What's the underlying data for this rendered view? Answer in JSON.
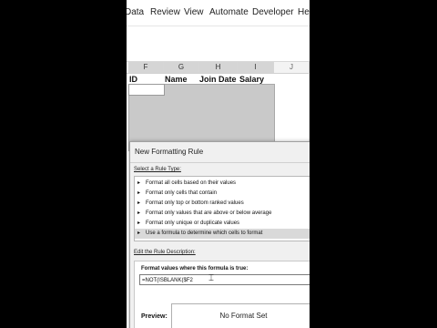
{
  "ribbon": {
    "tabs": [
      "Data",
      "Review",
      "View",
      "Automate",
      "Developer",
      "Help"
    ]
  },
  "sheet": {
    "columns": [
      "F",
      "G",
      "H",
      "I",
      "J"
    ],
    "headers": [
      "ID",
      "Name",
      "Join Date",
      "Salary"
    ]
  },
  "dialog": {
    "title": "New Formatting Rule",
    "rule_type_label": "Select a Rule Type:",
    "rule_types": [
      "Format all cells based on their values",
      "Format only cells that contain",
      "Format only top or bottom ranked values",
      "Format only values that are above or below average",
      "Format only unique or duplicate values",
      "Use a formula to determine which cells to format"
    ],
    "selected_rule_index": 5,
    "edit_label": "Edit the Rule Description:",
    "formula_label": "Format values where this formula is true:",
    "formula_value": "=NOT(ISBLANK($F2",
    "preview_label": "Preview:",
    "preview_text": "No Format Set"
  },
  "colors": {
    "selection_fill": "#c9c9c9",
    "dialog_bg": "#f0f0f0",
    "selected_rule_bg": "#d9d9d9"
  }
}
